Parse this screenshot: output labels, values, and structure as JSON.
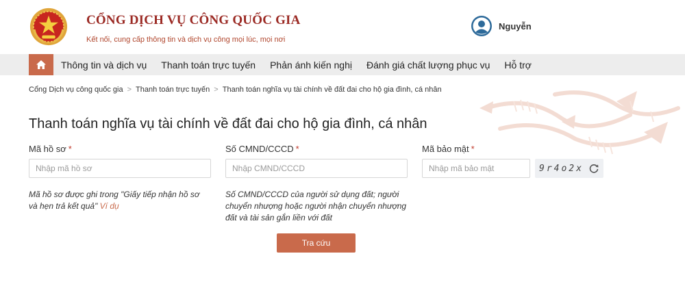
{
  "header": {
    "title": "CỔNG DỊCH VỤ CÔNG QUỐC GIA",
    "tagline": "Kết nối, cung cấp thông tin và dịch vụ công mọi lúc, mọi nơi",
    "user_name": "Nguyễn"
  },
  "nav": {
    "items": [
      {
        "label": "Thông tin và dịch vụ"
      },
      {
        "label": "Thanh toán trực tuyến"
      },
      {
        "label": "Phản ánh kiến nghị"
      },
      {
        "label": "Đánh giá chất lượng phục vụ"
      },
      {
        "label": "Hỗ trợ"
      }
    ]
  },
  "breadcrumb": {
    "items": [
      "Cổng Dịch vụ công quốc gia",
      "Thanh toán trực tuyến",
      "Thanh toán nghĩa vụ tài chính về đất đai cho hộ gia đình, cá nhân"
    ]
  },
  "page": {
    "title": "Thanh toán nghĩa vụ tài chính về đất đai cho hộ gia đình, cá nhân"
  },
  "form": {
    "record": {
      "label": "Mã hồ sơ",
      "placeholder": "Nhập mã hồ sơ",
      "value": "",
      "hint": "Mã hồ sơ được ghi trong \"Giấy tiếp nhận hồ sơ và hẹn trả kết quả\"",
      "example_link": "Ví dụ"
    },
    "id_card": {
      "label": "Số CMND/CCCD",
      "placeholder": "Nhập CMND/CCCD",
      "value": "",
      "hint": "Số CMND/CCCD của người sử dụng đất; người chuyển nhượng hoặc người nhận chuyển nhượng đất và tài sản gắn liền với đất"
    },
    "security": {
      "label": "Mã bảo mật",
      "placeholder": "Nhập mã bảo mật",
      "value": "",
      "captcha": "9r4o2x"
    },
    "required_mark": "*",
    "submit_label": "Tra cứu"
  },
  "colors": {
    "accent": "#c96a4b",
    "brand": "#9b2a24",
    "nav_bg": "#ededed",
    "required": "#c0392b"
  },
  "icons": {
    "emblem": "national-emblem-icon",
    "avatar": "user-avatar-icon",
    "home": "home-icon",
    "refresh": "refresh-icon",
    "separator": "chevron-right-icon"
  }
}
